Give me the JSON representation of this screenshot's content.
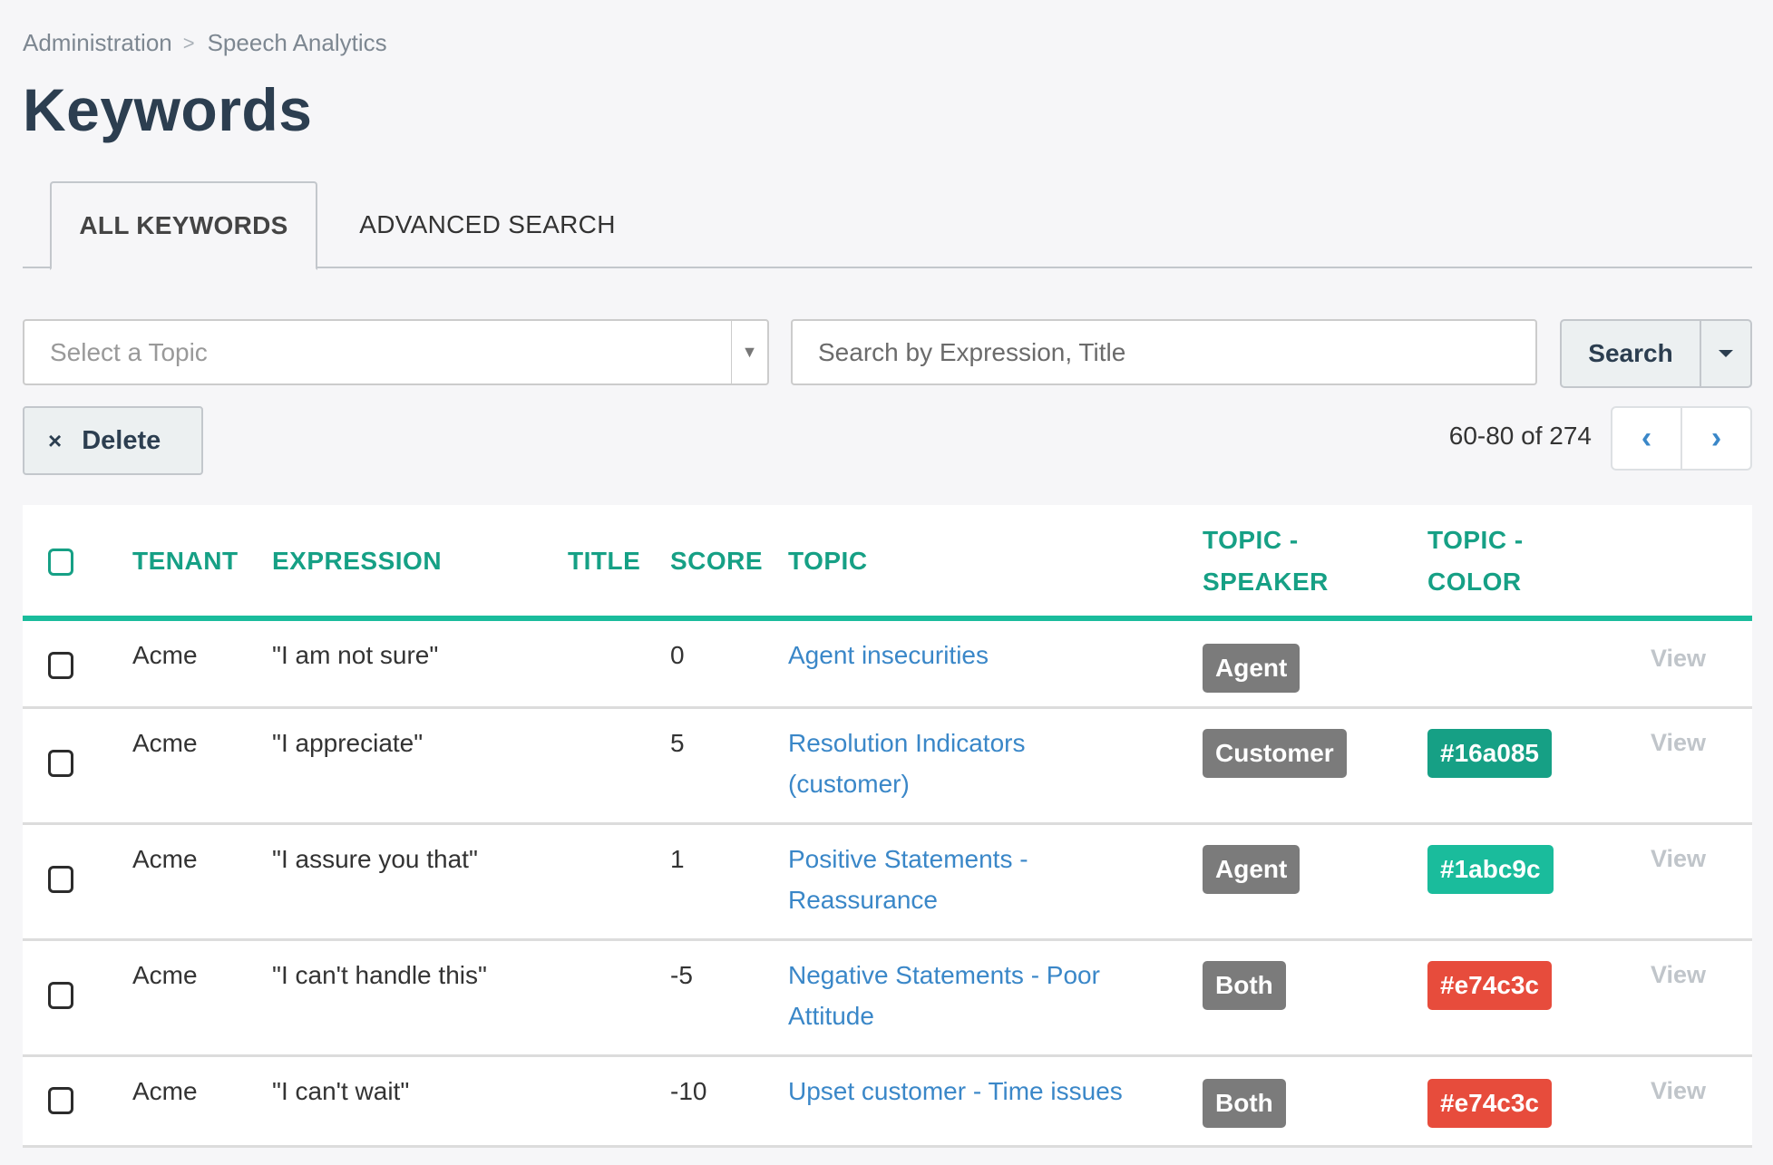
{
  "breadcrumb": {
    "items": [
      "Administration",
      "Speech Analytics"
    ],
    "separator": ">"
  },
  "page": {
    "title": "Keywords"
  },
  "tabs": [
    {
      "label": "ALL KEYWORDS",
      "active": true
    },
    {
      "label": "ADVANCED SEARCH",
      "active": false
    }
  ],
  "filters": {
    "topic_select": {
      "placeholder": "Select a Topic",
      "value": ""
    },
    "search_input": {
      "placeholder": "Search by Expression, Title",
      "value": ""
    },
    "search_button": "Search"
  },
  "actions": {
    "delete_icon": "×",
    "delete_label": "Delete"
  },
  "pagination": {
    "range_text": "60-80 of 274",
    "prev_icon": "‹",
    "next_icon": "›"
  },
  "colors": {
    "accent": "#1abc9c",
    "header_text": "#16a085",
    "link": "#3a87c8",
    "speaker_badge": "#7b7b7b"
  },
  "table": {
    "columns": [
      "TENANT",
      "EXPRESSION",
      "TITLE",
      "SCORE",
      "TOPIC",
      "TOPIC -",
      "SPEAKER",
      "TOPIC -",
      "COLOR"
    ],
    "column_labels": {
      "tenant": "TENANT",
      "expression": "EXPRESSION",
      "title": "TITLE",
      "score": "SCORE",
      "topic": "TOPIC",
      "topic_speaker_1": "TOPIC -",
      "topic_speaker_2": "SPEAKER",
      "topic_color_1": "TOPIC -",
      "topic_color_2": "COLOR"
    },
    "rows": [
      {
        "tenant": "Acme",
        "expression": "\"I am not sure\"",
        "title": "",
        "score": "0",
        "topic_l1": "Agent insecurities",
        "topic_l2": "",
        "speaker": "Agent",
        "color": "",
        "view": "View"
      },
      {
        "tenant": "Acme",
        "expression": "\"I appreciate\"",
        "title": "",
        "score": "5",
        "topic_l1": "Resolution Indicators",
        "topic_l2": "(customer)",
        "speaker": "Customer",
        "color": "#16a085",
        "view": "View"
      },
      {
        "tenant": "Acme",
        "expression": "\"I assure you that\"",
        "title": "",
        "score": "1",
        "topic_l1": "Positive Statements -",
        "topic_l2": "Reassurance",
        "speaker": "Agent",
        "color": "#1abc9c",
        "view": "View"
      },
      {
        "tenant": "Acme",
        "expression": "\"I can't handle this\"",
        "title": "",
        "score": "-5",
        "topic_l1": "Negative Statements - Poor",
        "topic_l2": "Attitude",
        "speaker": "Both",
        "color": "#e74c3c",
        "view": "View"
      },
      {
        "tenant": "Acme",
        "expression": "\"I can't wait\"",
        "title": "",
        "score": "-10",
        "topic_l1": "Upset customer - Time issues",
        "topic_l2": "",
        "speaker": "Both",
        "color": "#e74c3c",
        "view": "View"
      }
    ]
  }
}
